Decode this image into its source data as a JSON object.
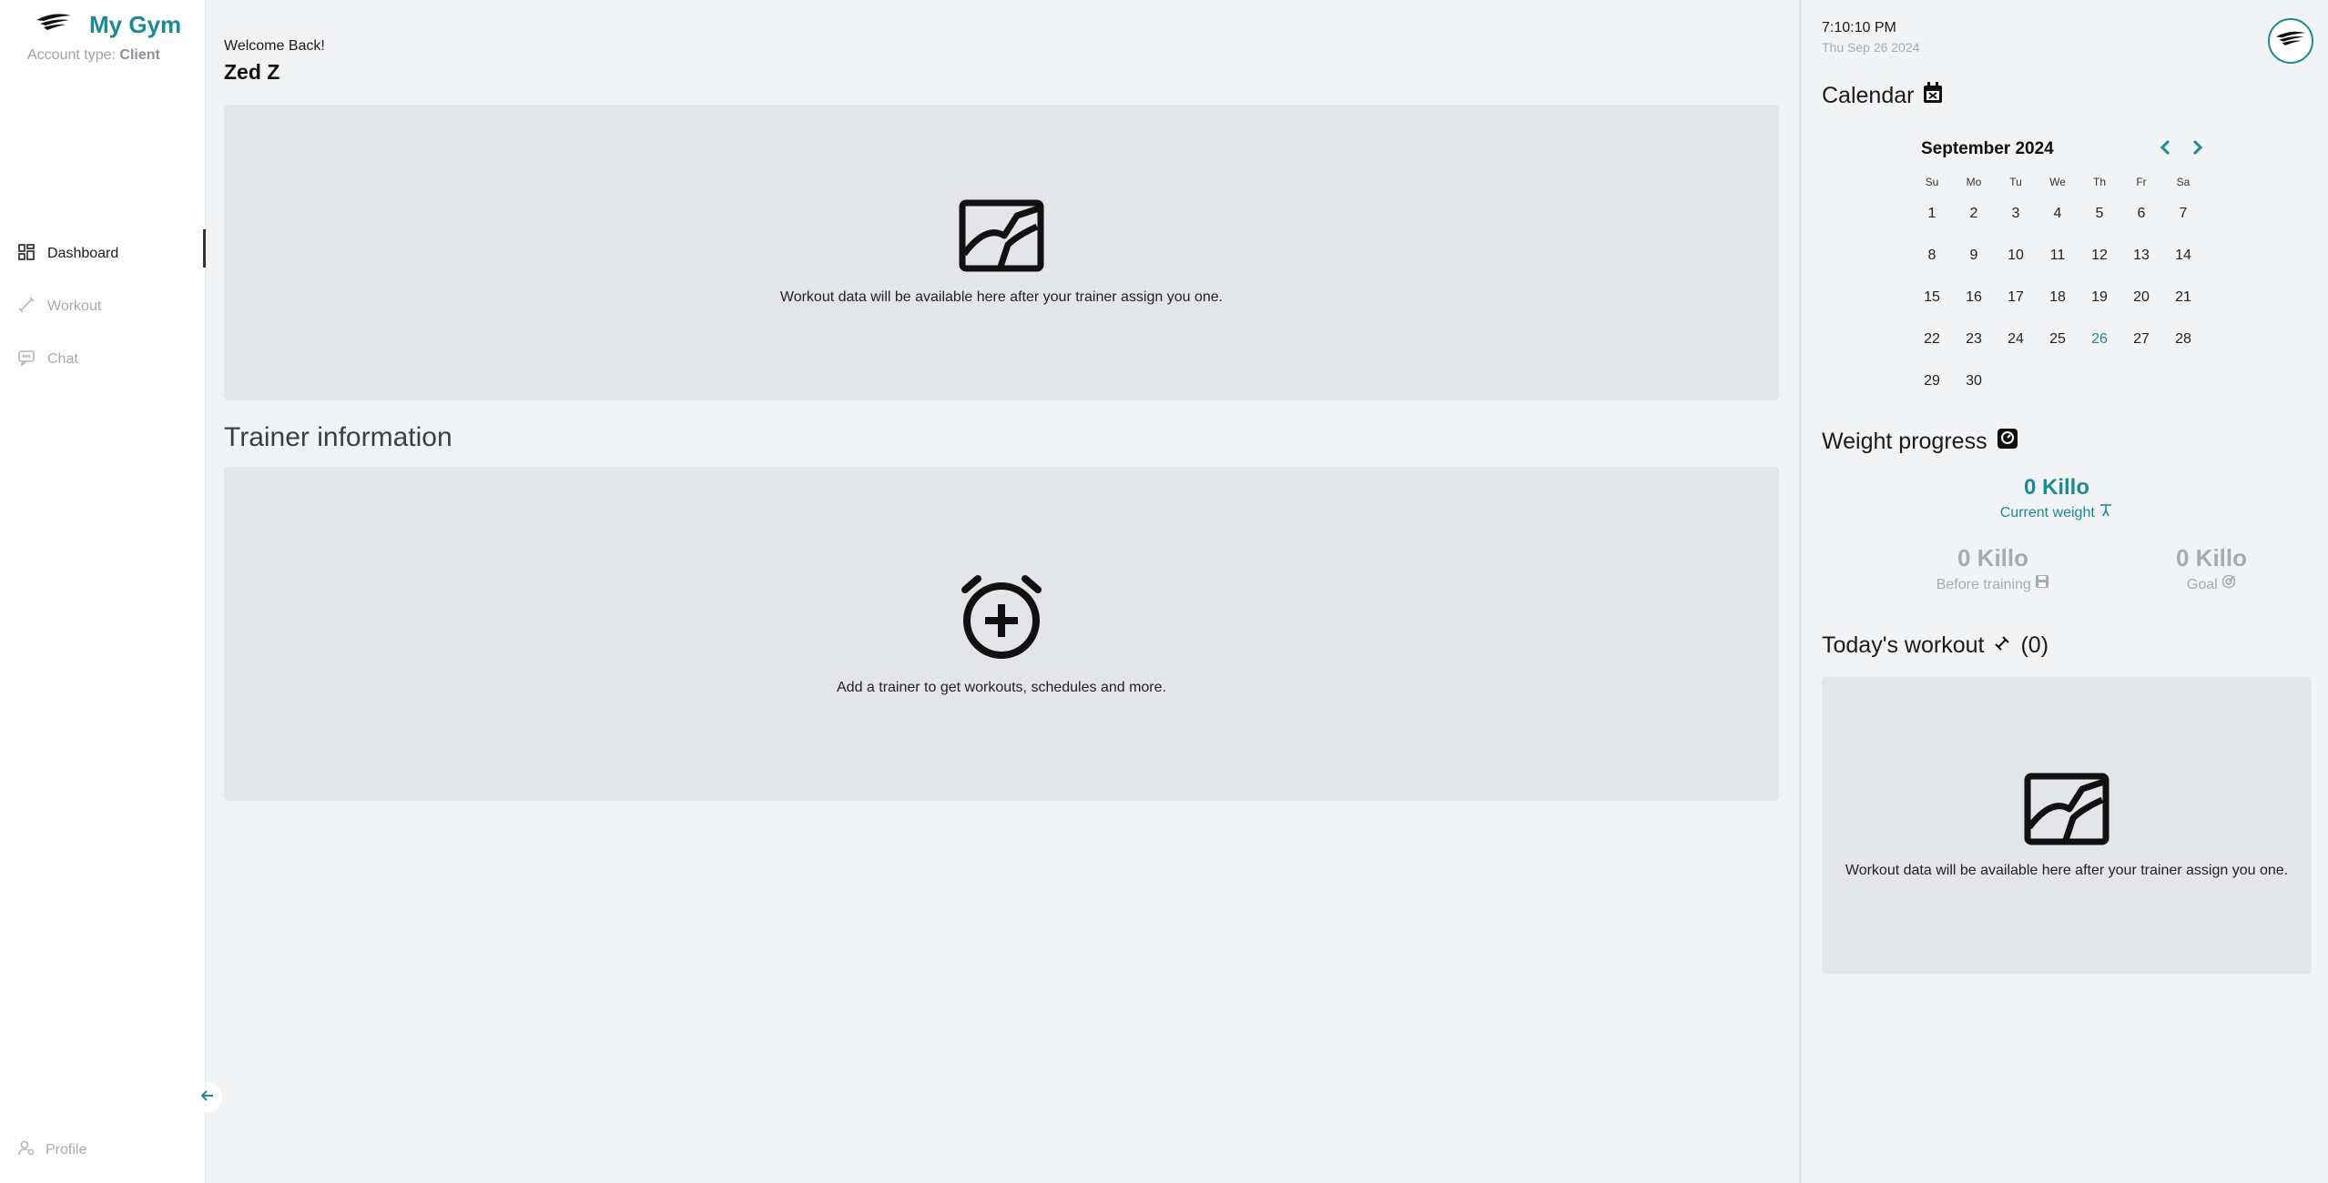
{
  "app": {
    "name": "My Gym",
    "account_type_label": "Account type:",
    "account_type_value": "Client"
  },
  "sidebar": {
    "items": [
      {
        "label": "Dashboard",
        "icon": "dashboard-icon",
        "active": true
      },
      {
        "label": "Workout",
        "icon": "workout-icon",
        "active": false
      },
      {
        "label": "Chat",
        "icon": "chat-icon",
        "active": false
      }
    ],
    "profile_label": "Profile",
    "collapse_icon": "arrow-left-icon"
  },
  "main": {
    "welcome": "Welcome Back!",
    "user_name": "Zed Z",
    "workout_empty_message": "Workout data will be available here after your trainer assign you one.",
    "trainer_section_title": "Trainer information",
    "trainer_empty_message": "Add a trainer to get workouts, schedules and more."
  },
  "right_panel": {
    "time": "7:10:10 PM",
    "date": "Thu Sep 26 2024",
    "calendar": {
      "title": "Calendar",
      "month": "September 2024",
      "weekdays": [
        "Su",
        "Mo",
        "Tu",
        "We",
        "Th",
        "Fr",
        "Sa"
      ],
      "days": [
        "1",
        "2",
        "3",
        "4",
        "5",
        "6",
        "7",
        "8",
        "9",
        "10",
        "11",
        "12",
        "13",
        "14",
        "15",
        "16",
        "17",
        "18",
        "19",
        "20",
        "21",
        "22",
        "23",
        "24",
        "25",
        "26",
        "27",
        "28",
        "29",
        "30"
      ],
      "today": "26"
    },
    "weight": {
      "title": "Weight progress",
      "current_value": "0 Killo",
      "current_label": "Current weight",
      "before_value": "0 Killo",
      "before_label": "Before training",
      "goal_value": "0 Killo",
      "goal_label": "Goal"
    },
    "todays_workout": {
      "title": "Today's workout",
      "count": "(0)",
      "empty_message": "Workout data will be available here after your trainer assign you one."
    }
  },
  "colors": {
    "accent": "#1b8a96",
    "muted": "#a7abb1",
    "panel_bg": "#e4e5e8",
    "page_bg": "#f2f3f5"
  }
}
